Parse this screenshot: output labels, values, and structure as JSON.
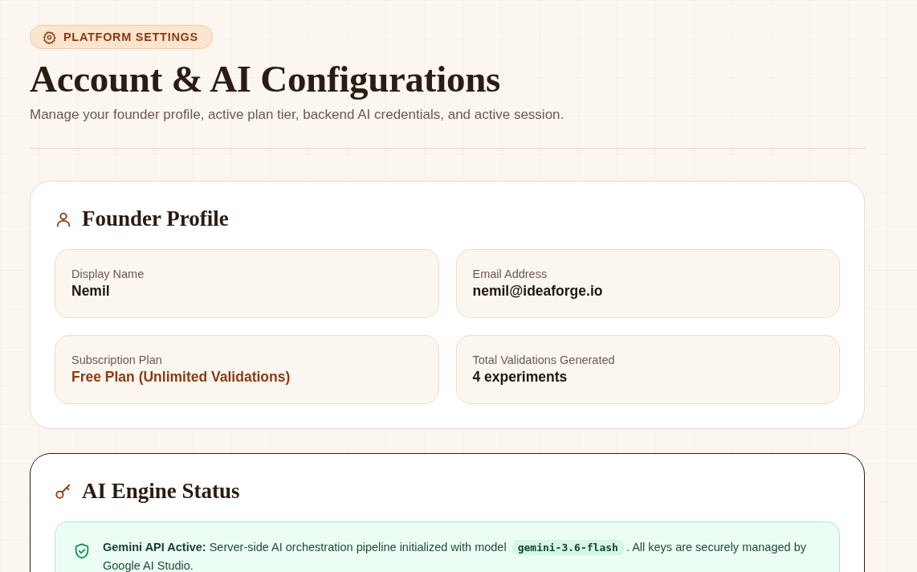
{
  "badge": {
    "label": "PLATFORM SETTINGS"
  },
  "title": "Account & AI Configurations",
  "subtitle": "Manage your founder profile, active plan tier, backend AI credentials, and active session.",
  "profile": {
    "title": "Founder Profile",
    "fields": [
      {
        "label": "Display Name",
        "value": "Nemil",
        "kind": "plain"
      },
      {
        "label": "Email Address",
        "value": "nemil@ideaforge.io",
        "kind": "plain"
      },
      {
        "label": "Subscription Plan",
        "value": "Free Plan (Unlimited Validations)",
        "kind": "accent"
      },
      {
        "label": "Total Validations Generated",
        "value": "4 experiments",
        "kind": "plain"
      }
    ]
  },
  "engine": {
    "title": "AI Engine Status",
    "focused": true,
    "status": {
      "message": "**Gemini API Active:** Server-side AI orchestration pipeline initialized with model",
      "model": "gemini-3.6-flash",
      "message_end": ". All keys are securely managed by Google AI Studio."
    }
  }
}
